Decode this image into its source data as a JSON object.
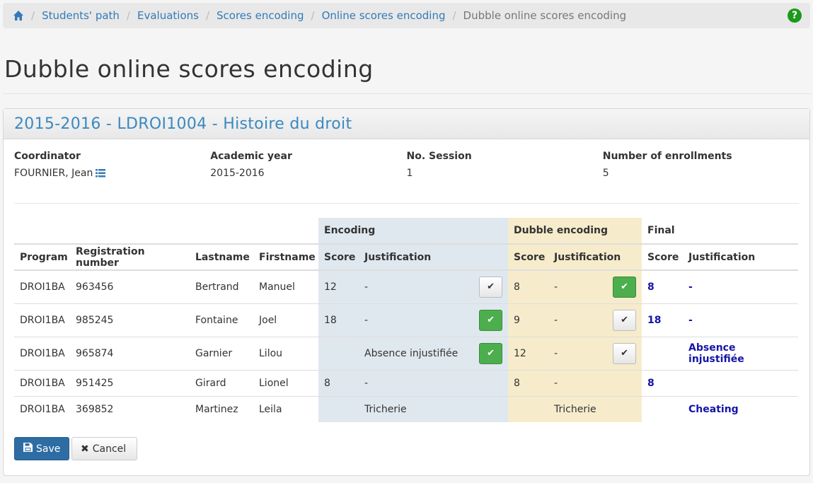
{
  "breadcrumb": {
    "home_icon": "home-icon",
    "items": [
      "Students' path",
      "Evaluations",
      "Scores encoding",
      "Online scores encoding"
    ],
    "active": "Dubble online scores encoding",
    "help_icon": "question-circle-icon",
    "help_glyph": "?"
  },
  "page": {
    "title": "Dubble online scores encoding"
  },
  "panel": {
    "title": "2015-2016 - LDROI1004 - Histoire du droit",
    "info": {
      "coordinator_label": "Coordinator",
      "coordinator_value": "FOURNIER, Jean",
      "academic_year_label": "Academic year",
      "academic_year_value": "2015-2016",
      "session_label": "No. Session",
      "session_value": "1",
      "enrollments_label": "Number of enrollments",
      "enrollments_value": "5"
    }
  },
  "table": {
    "groups": {
      "encoding": "Encoding",
      "dubble": "Dubble encoding",
      "final": "Final"
    },
    "headers": {
      "program": "Program",
      "registration": "Registration number",
      "lastname": "Lastname",
      "firstname": "Firstname",
      "enc_score": "Score",
      "enc_just": "Justification",
      "dub_score": "Score",
      "dub_just": "Justification",
      "final_score": "Score",
      "final_just": "Justification"
    },
    "rows": [
      {
        "program": "DROI1BA",
        "registration": "963456",
        "lastname": "Bertrand",
        "firstname": "Manuel",
        "enc_score": "12",
        "enc_just": "-",
        "dub_score": "8",
        "dub_just": "-",
        "final_score": "8",
        "final_just": "-"
      },
      {
        "program": "DROI1BA",
        "registration": "985245",
        "lastname": "Fontaine",
        "firstname": "Joel",
        "enc_score": "18",
        "enc_just": "-",
        "dub_score": "9",
        "dub_just": "-",
        "final_score": "18",
        "final_just": "-"
      },
      {
        "program": "DROI1BA",
        "registration": "965874",
        "lastname": "Garnier",
        "firstname": "Lilou",
        "enc_score": "",
        "enc_just": "Absence injustifiée",
        "dub_score": "12",
        "dub_just": "-",
        "final_score": "",
        "final_just": "Absence injustifiée"
      },
      {
        "program": "DROI1BA",
        "registration": "951425",
        "lastname": "Girard",
        "firstname": "Lionel",
        "enc_score": "8",
        "enc_just": "-",
        "dub_score": "8",
        "dub_just": "-",
        "final_score": "8",
        "final_just": ""
      },
      {
        "program": "DROI1BA",
        "registration": "369852",
        "lastname": "Martinez",
        "firstname": "Leila",
        "enc_score": "",
        "enc_just": "Tricherie",
        "dub_score": "",
        "dub_just": "Tricherie",
        "final_score": "",
        "final_just": "Cheating"
      }
    ],
    "check_glyph": "✔"
  },
  "actions": {
    "save_label": "Save",
    "save_icon": "floppy-disk-icon",
    "cancel_label": "Cancel",
    "cancel_icon": "close-icon",
    "cancel_glyph": "✖"
  },
  "colors": {
    "link": "#337ab7",
    "encoding_bg": "#e0e8ef",
    "dubble_bg": "#f6eccc",
    "final_value": "#1515a8",
    "selected_button": "#4cae4c",
    "primary_button": "#2e6da4",
    "help_icon": "#1a9a1a"
  }
}
